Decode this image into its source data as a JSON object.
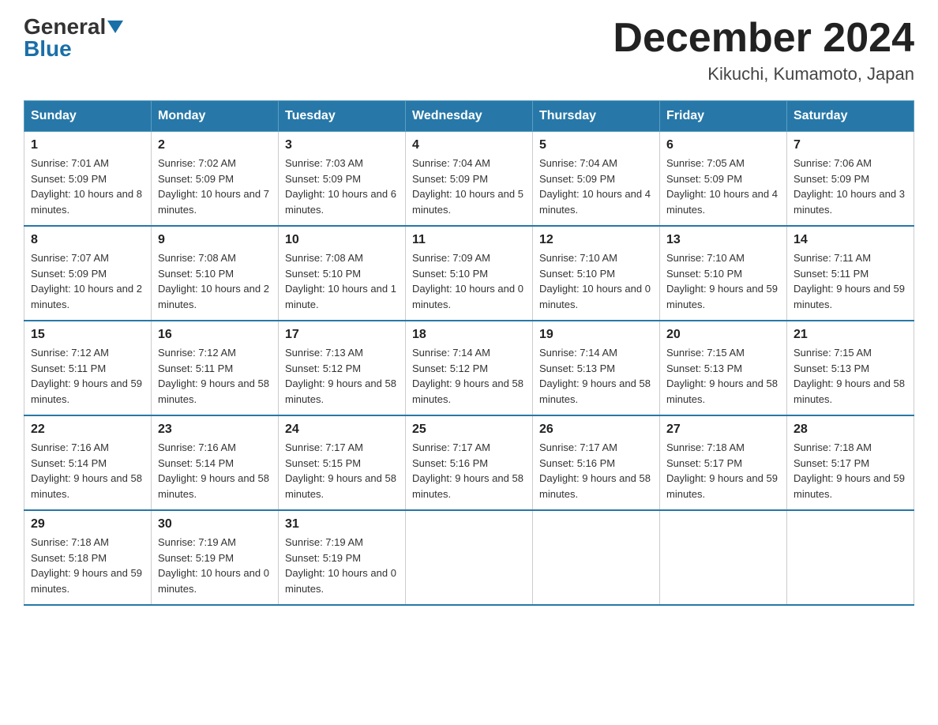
{
  "header": {
    "logo_general": "General",
    "logo_blue": "Blue",
    "title": "December 2024",
    "subtitle": "Kikuchi, Kumamoto, Japan"
  },
  "days_of_week": [
    "Sunday",
    "Monday",
    "Tuesday",
    "Wednesday",
    "Thursday",
    "Friday",
    "Saturday"
  ],
  "weeks": [
    [
      {
        "day": "1",
        "sunrise": "7:01 AM",
        "sunset": "5:09 PM",
        "daylight": "10 hours and 8 minutes."
      },
      {
        "day": "2",
        "sunrise": "7:02 AM",
        "sunset": "5:09 PM",
        "daylight": "10 hours and 7 minutes."
      },
      {
        "day": "3",
        "sunrise": "7:03 AM",
        "sunset": "5:09 PM",
        "daylight": "10 hours and 6 minutes."
      },
      {
        "day": "4",
        "sunrise": "7:04 AM",
        "sunset": "5:09 PM",
        "daylight": "10 hours and 5 minutes."
      },
      {
        "day": "5",
        "sunrise": "7:04 AM",
        "sunset": "5:09 PM",
        "daylight": "10 hours and 4 minutes."
      },
      {
        "day": "6",
        "sunrise": "7:05 AM",
        "sunset": "5:09 PM",
        "daylight": "10 hours and 4 minutes."
      },
      {
        "day": "7",
        "sunrise": "7:06 AM",
        "sunset": "5:09 PM",
        "daylight": "10 hours and 3 minutes."
      }
    ],
    [
      {
        "day": "8",
        "sunrise": "7:07 AM",
        "sunset": "5:09 PM",
        "daylight": "10 hours and 2 minutes."
      },
      {
        "day": "9",
        "sunrise": "7:08 AM",
        "sunset": "5:10 PM",
        "daylight": "10 hours and 2 minutes."
      },
      {
        "day": "10",
        "sunrise": "7:08 AM",
        "sunset": "5:10 PM",
        "daylight": "10 hours and 1 minute."
      },
      {
        "day": "11",
        "sunrise": "7:09 AM",
        "sunset": "5:10 PM",
        "daylight": "10 hours and 0 minutes."
      },
      {
        "day": "12",
        "sunrise": "7:10 AM",
        "sunset": "5:10 PM",
        "daylight": "10 hours and 0 minutes."
      },
      {
        "day": "13",
        "sunrise": "7:10 AM",
        "sunset": "5:10 PM",
        "daylight": "9 hours and 59 minutes."
      },
      {
        "day": "14",
        "sunrise": "7:11 AM",
        "sunset": "5:11 PM",
        "daylight": "9 hours and 59 minutes."
      }
    ],
    [
      {
        "day": "15",
        "sunrise": "7:12 AM",
        "sunset": "5:11 PM",
        "daylight": "9 hours and 59 minutes."
      },
      {
        "day": "16",
        "sunrise": "7:12 AM",
        "sunset": "5:11 PM",
        "daylight": "9 hours and 58 minutes."
      },
      {
        "day": "17",
        "sunrise": "7:13 AM",
        "sunset": "5:12 PM",
        "daylight": "9 hours and 58 minutes."
      },
      {
        "day": "18",
        "sunrise": "7:14 AM",
        "sunset": "5:12 PM",
        "daylight": "9 hours and 58 minutes."
      },
      {
        "day": "19",
        "sunrise": "7:14 AM",
        "sunset": "5:13 PM",
        "daylight": "9 hours and 58 minutes."
      },
      {
        "day": "20",
        "sunrise": "7:15 AM",
        "sunset": "5:13 PM",
        "daylight": "9 hours and 58 minutes."
      },
      {
        "day": "21",
        "sunrise": "7:15 AM",
        "sunset": "5:13 PM",
        "daylight": "9 hours and 58 minutes."
      }
    ],
    [
      {
        "day": "22",
        "sunrise": "7:16 AM",
        "sunset": "5:14 PM",
        "daylight": "9 hours and 58 minutes."
      },
      {
        "day": "23",
        "sunrise": "7:16 AM",
        "sunset": "5:14 PM",
        "daylight": "9 hours and 58 minutes."
      },
      {
        "day": "24",
        "sunrise": "7:17 AM",
        "sunset": "5:15 PM",
        "daylight": "9 hours and 58 minutes."
      },
      {
        "day": "25",
        "sunrise": "7:17 AM",
        "sunset": "5:16 PM",
        "daylight": "9 hours and 58 minutes."
      },
      {
        "day": "26",
        "sunrise": "7:17 AM",
        "sunset": "5:16 PM",
        "daylight": "9 hours and 58 minutes."
      },
      {
        "day": "27",
        "sunrise": "7:18 AM",
        "sunset": "5:17 PM",
        "daylight": "9 hours and 59 minutes."
      },
      {
        "day": "28",
        "sunrise": "7:18 AM",
        "sunset": "5:17 PM",
        "daylight": "9 hours and 59 minutes."
      }
    ],
    [
      {
        "day": "29",
        "sunrise": "7:18 AM",
        "sunset": "5:18 PM",
        "daylight": "9 hours and 59 minutes."
      },
      {
        "day": "30",
        "sunrise": "7:19 AM",
        "sunset": "5:19 PM",
        "daylight": "10 hours and 0 minutes."
      },
      {
        "day": "31",
        "sunrise": "7:19 AM",
        "sunset": "5:19 PM",
        "daylight": "10 hours and 0 minutes."
      },
      null,
      null,
      null,
      null
    ]
  ]
}
